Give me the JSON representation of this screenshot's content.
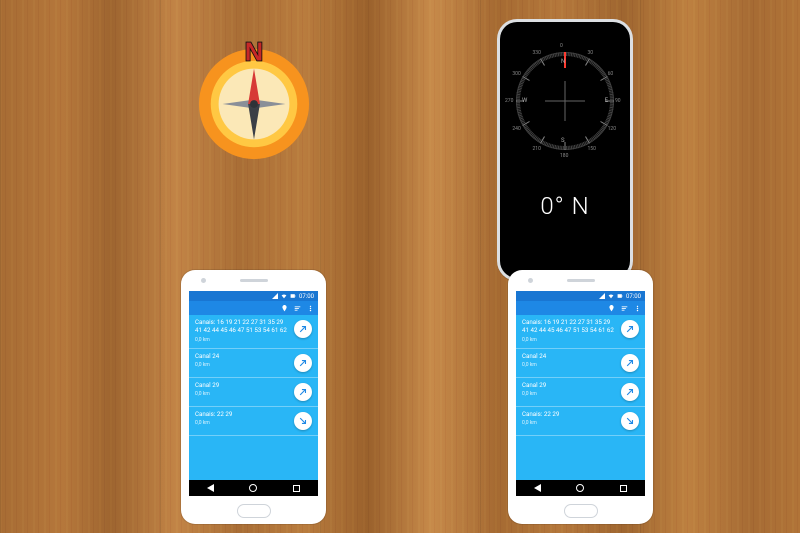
{
  "compass_badge": {
    "letter": "N"
  },
  "iphone": {
    "bearing": "0° N",
    "cardinals": {
      "n": "N",
      "e": "E",
      "s": "S",
      "w": "W"
    },
    "deg_labels": [
      "0",
      "30",
      "60",
      "90",
      "120",
      "150",
      "180",
      "210",
      "240",
      "270",
      "300",
      "330"
    ]
  },
  "android_app": {
    "statusbar": {
      "signal": "signal",
      "wifi": "wifi",
      "battery": "batt",
      "time": "07:00"
    },
    "toolbar": {
      "pin": "pin",
      "sort": "sort",
      "more": "more"
    },
    "rows": [
      {
        "title": "Canais: 16 19 21 22\n27 31 35 29 41 42 44\n45 46 47 51 53 54 61\n62",
        "sub": "0,0 km",
        "arrow_deg": 45
      },
      {
        "title": "Canal 24",
        "sub": "0,0 km",
        "arrow_deg": 45
      },
      {
        "title": "Canal 29",
        "sub": "0,0 km",
        "arrow_deg": 45
      },
      {
        "title": "Canais: 22 29",
        "sub": "0,0 km",
        "arrow_deg": 135
      }
    ]
  }
}
